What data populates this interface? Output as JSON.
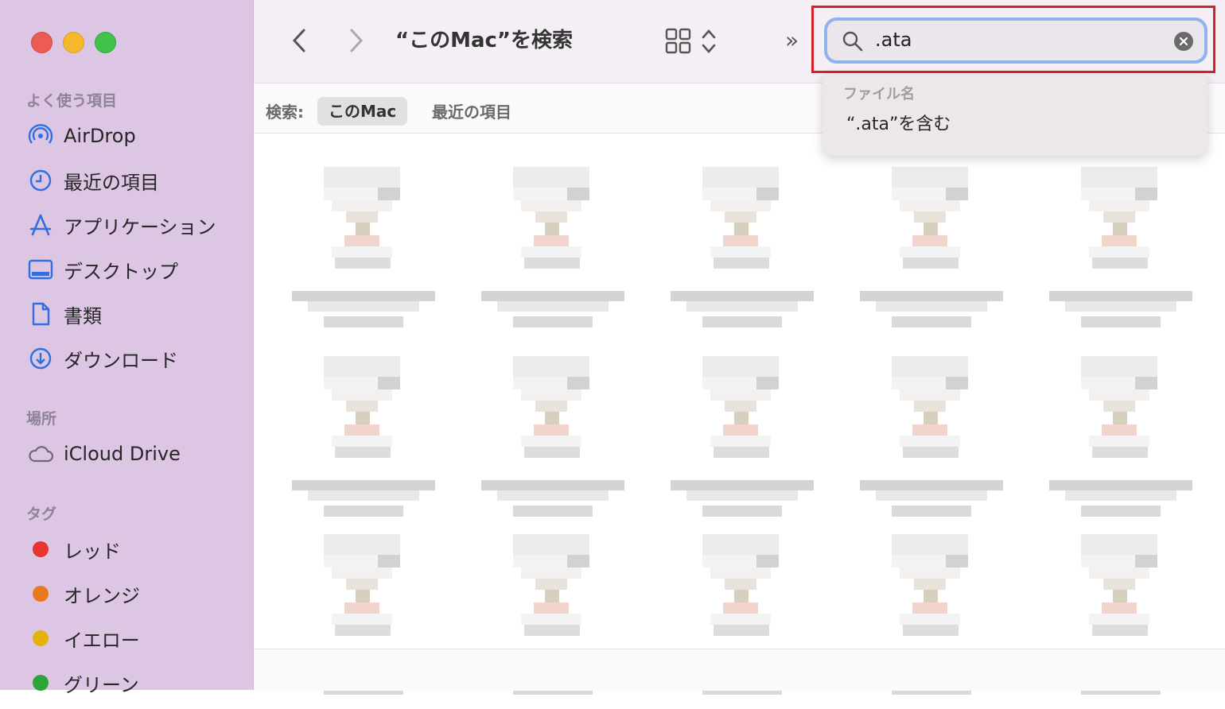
{
  "sidebar": {
    "favorites_title": "よく使う項目",
    "favorites": [
      {
        "label": "AirDrop",
        "icon": "airdrop-icon"
      },
      {
        "label": "最近の項目",
        "icon": "clock-icon"
      },
      {
        "label": "アプリケーション",
        "icon": "applications-icon"
      },
      {
        "label": "デスクトップ",
        "icon": "desktop-icon"
      },
      {
        "label": "書類",
        "icon": "document-icon"
      },
      {
        "label": "ダウンロード",
        "icon": "download-icon"
      }
    ],
    "locations_title": "場所",
    "locations": [
      {
        "label": "iCloud Drive",
        "icon": "cloud-icon"
      }
    ],
    "tags_title": "タグ",
    "tags": [
      {
        "label": "レッド",
        "color": "#e8332f"
      },
      {
        "label": "オレンジ",
        "color": "#e9781e"
      },
      {
        "label": "イエロー",
        "color": "#e3b30c"
      },
      {
        "label": "グリーン",
        "color": "#2da43a"
      }
    ]
  },
  "toolbar": {
    "title": "“このMac”を検索",
    "more": "»"
  },
  "search": {
    "value": ".ata"
  },
  "scope": {
    "label": "検索:",
    "active": "このMac",
    "other": "最近の項目"
  },
  "dropdown": {
    "section": "ファイル名",
    "suggestion": "“.ata”を含む"
  },
  "colors": {
    "sidebar": "#dcc6e3",
    "accent": "#2f6fe0",
    "highlight": "#d8202a",
    "close": "#ee5b52",
    "minimize": "#f5b82d",
    "zoom": "#3fc34a"
  }
}
